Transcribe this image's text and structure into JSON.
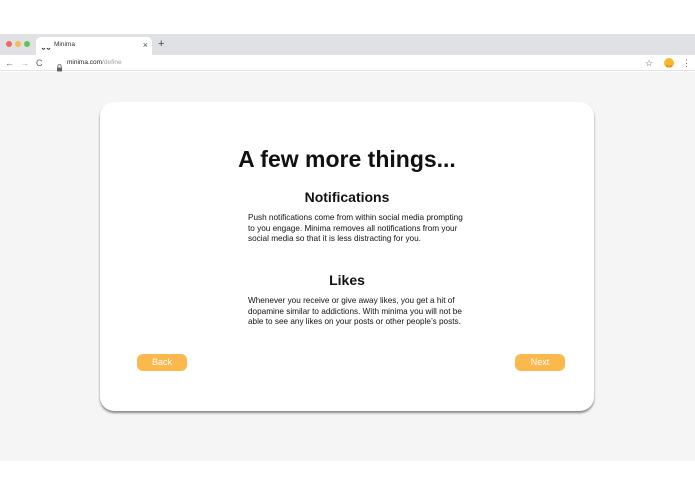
{
  "browser": {
    "tab": {
      "title": "Minima",
      "close_glyph": "×"
    },
    "new_tab_glyph": "+",
    "nav": {
      "back_glyph": "←",
      "forward_glyph": "→",
      "reload_glyph": "C"
    },
    "url": {
      "host": "minima.com",
      "path": "/define"
    },
    "icons": [
      "minima-favicon-icon",
      "lock-icon",
      "star-icon",
      "extension-avatar-icon",
      "menu-icon"
    ],
    "star_glyph": "☆",
    "menu_glyph": "⋮"
  },
  "page": {
    "title": "A few more things...",
    "sections": [
      {
        "heading": "Notifications",
        "body": "Push notifications come from within social media prompting to you engage. Minima removes all notifications from your social media so that it is less distracting for you."
      },
      {
        "heading": "Likes",
        "body": "Whenever you receive or give away likes, you get a hit of dopamine similar to addictions. With minima you will not be able to see any likes on your posts or other people’s posts."
      }
    ],
    "buttons": {
      "back": "Back",
      "next": "Next"
    }
  },
  "colors": {
    "accent": "#fab84d",
    "page_background": "#f5f5f5",
    "card_background": "#ffffff",
    "tab_strip": "#dfe1e5"
  }
}
